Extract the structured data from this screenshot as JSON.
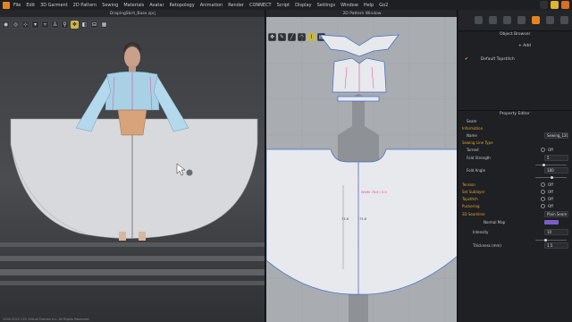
{
  "menu": [
    "File",
    "Edit",
    "3D Garment",
    "2D Pattern",
    "Sewing",
    "Materials",
    "Avatar",
    "Retopology",
    "Animation",
    "Render",
    "CONNECT",
    "Script",
    "Display",
    "Settings",
    "Window",
    "Help",
    "Go2"
  ],
  "view3d": {
    "title": "DrapingSkirt_Base.zprj"
  },
  "view2d": {
    "title": "2D Pattern Window"
  },
  "measure_labels": [
    "Width 76.6 / 0.0",
    "73.6",
    "73.6"
  ],
  "object_browser": {
    "title": "Object Browser",
    "add_label": "+ Add",
    "items": [
      "Default Topstitch"
    ]
  },
  "property_editor": {
    "title": "Property Editor",
    "object_label": "Seam",
    "sections": {
      "information": "Information",
      "sewing_line_type": "Sewing Line Type",
      "seamline": "3D Seamline"
    },
    "rows": {
      "name": {
        "label": "Name",
        "value": "Sewing_1205"
      },
      "turned": {
        "label": "Turned",
        "value": "Off"
      },
      "fold_strength": {
        "label": "Fold Strength",
        "value": "5"
      },
      "fold_angle": {
        "label": "Fold Angle",
        "value": "180"
      },
      "tension": {
        "label": "Tension",
        "value": "Off"
      },
      "set_sublayer": {
        "label": "Set Sublayer",
        "value": "Off"
      },
      "topstitch": {
        "label": "Topstitch",
        "value": "Off"
      },
      "puckering": {
        "label": "Puckering",
        "value": "Off"
      },
      "seamline": {
        "value": "Plain Seam"
      },
      "normal_map": {
        "label": "Normal Map"
      },
      "intensity": {
        "label": "Intensity",
        "value": "10"
      },
      "thickness": {
        "label": "Thickness (mm)",
        "value": "1.5"
      }
    }
  },
  "status": "2000-2022 CLO Virtual Fashion Inc. All Rights Reserved.",
  "colors": {
    "accent": "#e7831f",
    "highlight": "#c9b64a",
    "seam": "#e4479b",
    "pattern_fill": "#e7e9ec"
  }
}
